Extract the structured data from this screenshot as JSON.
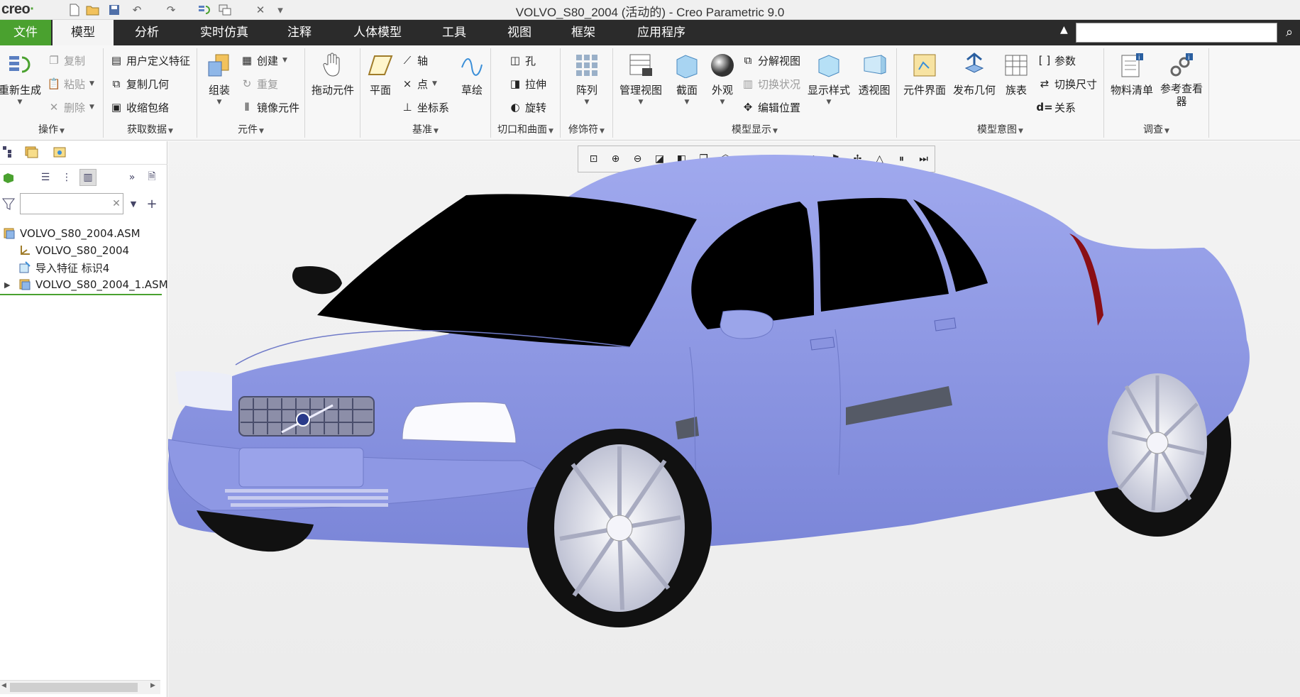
{
  "app": {
    "logo": "creo",
    "title": "VOLVO_S80_2004 (活动的) - Creo Parametric 9.0"
  },
  "quick_access": [
    "new-icon",
    "open-icon",
    "save-icon",
    "undo-icon",
    "redo-icon",
    "regenerate-icon",
    "windows-icon",
    "close-window-icon",
    "customize-icon"
  ],
  "tabs": [
    {
      "label": "文件"
    },
    {
      "label": "模型"
    },
    {
      "label": "分析"
    },
    {
      "label": "实时仿真"
    },
    {
      "label": "注释"
    },
    {
      "label": "人体模型"
    },
    {
      "label": "工具"
    },
    {
      "label": "视图"
    },
    {
      "label": "框架"
    },
    {
      "label": "应用程序"
    }
  ],
  "search": {
    "placeholder": ""
  },
  "ribbon": {
    "operations": {
      "label": "操作",
      "regenerate": "重新生成",
      "copy": "复制",
      "paste": "粘贴",
      "delete": "删除"
    },
    "get_data": {
      "label": "获取数据",
      "udf": "用户定义特征",
      "copy_geom": "复制几何",
      "shrinkwrap": "收缩包络"
    },
    "component": {
      "label": "元件",
      "assemble": "组装",
      "create": "创建",
      "repeat": "重复",
      "mirror": "镜像元件"
    },
    "drag": {
      "label": "拖动元件"
    },
    "datum": {
      "label": "基准",
      "plane": "平面",
      "axis": "轴",
      "point": "点",
      "csys": "坐标系",
      "sketch": "草绘"
    },
    "cut_surface": {
      "label": "切口和曲面",
      "hole": "孔",
      "extrude": "拉伸",
      "revolve": "旋转"
    },
    "modifiers": {
      "label": "修饰符",
      "pattern": "阵列"
    },
    "model_display": {
      "label": "模型显示",
      "manage_views": "管理视图",
      "section": "截面",
      "appearance": "外观",
      "explode": "分解视图",
      "toggle_status": "切换状况",
      "edit_position": "编辑位置",
      "display_style": "显示样式",
      "perspective": "透视图"
    },
    "model_intent": {
      "label": "模型意图",
      "comp_interface": "元件界面",
      "publish_geom": "发布几何",
      "family_table": "族表",
      "params": "参数",
      "switch_dims": "切换尺寸",
      "relations": "关系"
    },
    "investigate": {
      "label": "调查",
      "bom": "物料清单",
      "ref_viewer_1": "参考查看",
      "ref_viewer_2": "器"
    }
  },
  "tree": {
    "filter_placeholder": "",
    "items": [
      {
        "label": "VOLVO_S80_2004.ASM"
      },
      {
        "label": "VOLVO_S80_2004"
      },
      {
        "label": "导入特征 标识4"
      },
      {
        "label": "VOLVO_S80_2004_1.ASM"
      }
    ]
  },
  "colors": {
    "accent": "#4aa12f",
    "tab_bar": "#2b2b2b",
    "model": "#8f9ae6",
    "glass": "#000000"
  }
}
